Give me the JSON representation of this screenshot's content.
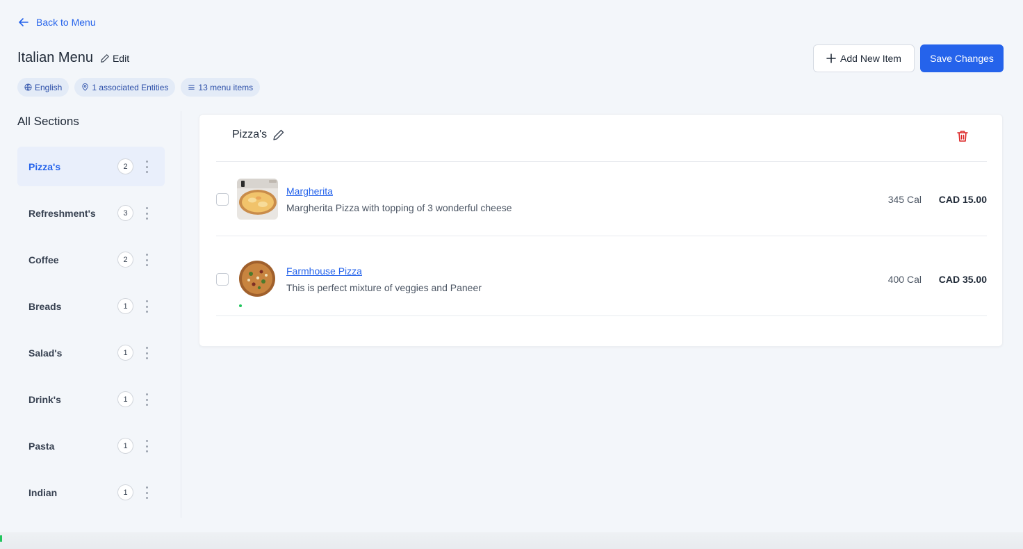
{
  "nav": {
    "back_label": "Back to Menu"
  },
  "header": {
    "title": "Italian Menu",
    "edit_label": "Edit",
    "chips": [
      {
        "icon": "globe-icon",
        "label": "English"
      },
      {
        "icon": "location-pin-icon",
        "label": "1 associated Entities"
      },
      {
        "icon": "list-icon",
        "label": "13 menu items"
      }
    ],
    "add_label": "Add New Item",
    "save_label": "Save Changes"
  },
  "sidebar": {
    "heading": "All Sections",
    "items": [
      {
        "label": "Pizza's",
        "count": "2",
        "active": true
      },
      {
        "label": "Refreshment's",
        "count": "3"
      },
      {
        "label": "Coffee",
        "count": "2"
      },
      {
        "label": "Breads",
        "count": "1"
      },
      {
        "label": "Salad's",
        "count": "1"
      },
      {
        "label": "Drink's",
        "count": "1"
      },
      {
        "label": "Pasta",
        "count": "1"
      },
      {
        "label": "Indian",
        "count": "1"
      }
    ]
  },
  "section": {
    "title": "Pizza's",
    "items": [
      {
        "name": "Margherita",
        "description": "Margherita Pizza with topping of 3 wonderful cheese",
        "calories": "345 Cal",
        "price": "CAD 15.00"
      },
      {
        "name": "Farmhouse Pizza",
        "description": "This is perfect mixture of veggies and Paneer",
        "calories": "400 Cal",
        "price": "CAD 35.00"
      }
    ]
  },
  "colors": {
    "accent": "#2563eb",
    "active_bg": "#e9effb",
    "danger": "#dc2626",
    "veg": "#22c55e"
  }
}
